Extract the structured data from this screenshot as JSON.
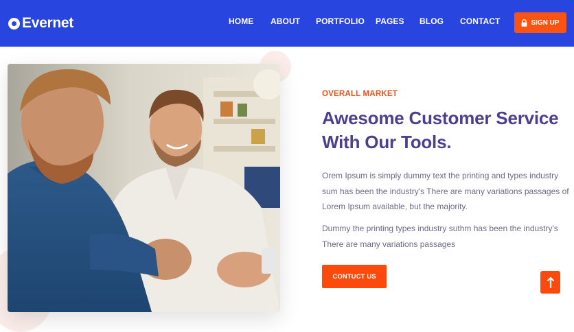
{
  "brand": {
    "name": "Evernet",
    "logo_icon": "circle-mark-icon"
  },
  "nav": {
    "items": [
      {
        "label": "HOME"
      },
      {
        "label": "ABOUT"
      },
      {
        "label": "PORTFOLIO"
      },
      {
        "label": "PAGES"
      },
      {
        "label": "BLOG"
      },
      {
        "label": "CONTACT"
      }
    ],
    "signup_label": "SIGN UP",
    "signup_icon": "lock-icon"
  },
  "hero": {
    "image_alt": "Two men looking at a phone and smiling",
    "eyebrow": "OVERALL MARKET",
    "title_line1": "Awesome Customer Service",
    "title_line2": "With Our Tools.",
    "paragraph1": "Orem Ipsum is simply dummy text the printing and types industry sum has been the industry's There are many variations passages of Lorem Ipsum available, but the majority.",
    "paragraph2": "Dummy the printing types industry suthm has been the industry's There are many variations passages",
    "cta_label": "CONTUCT US"
  },
  "scroll_top": {
    "icon": "arrow-up-icon"
  },
  "colors": {
    "header_bg": "#2845e0",
    "accent": "#fb4a0b",
    "heading": "#4e3f8e",
    "body_text": "#6c6a86",
    "eyebrow": "#e8531b"
  }
}
